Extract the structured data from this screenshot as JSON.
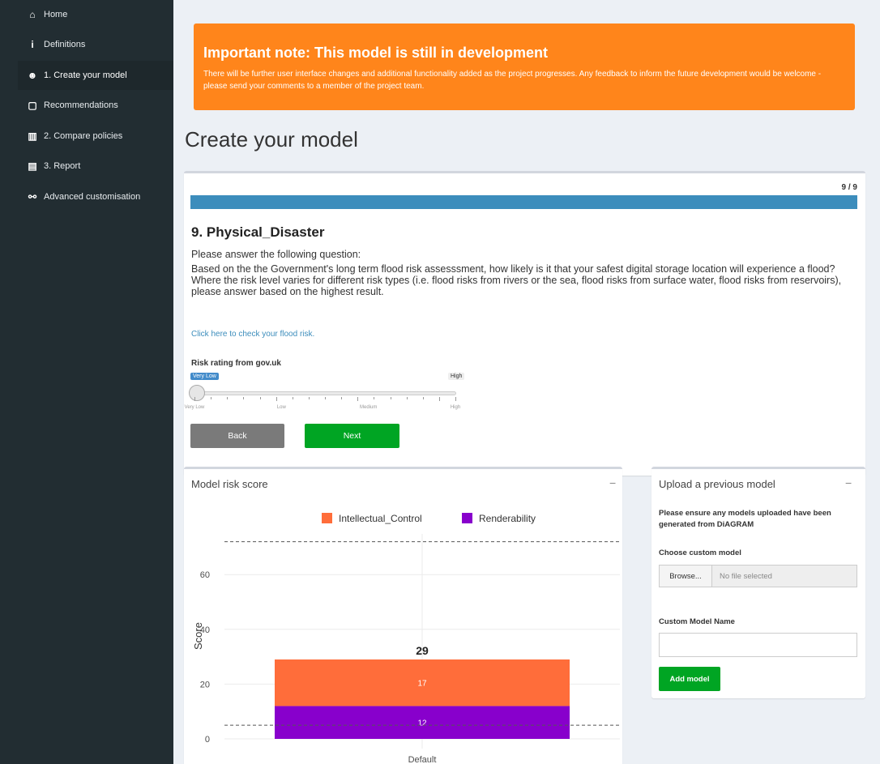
{
  "sidebar": {
    "items": [
      {
        "label": "Home",
        "icon": "home-icon",
        "glyph": "⌂"
      },
      {
        "label": "Definitions",
        "icon": "info-icon",
        "glyph": "i"
      },
      {
        "label": "1. Create your model",
        "icon": "user-edit-icon",
        "glyph": "☻"
      },
      {
        "label": "Recommendations",
        "icon": "clipboard-icon",
        "glyph": "▢"
      },
      {
        "label": "2. Compare policies",
        "icon": "bar-chart-icon",
        "glyph": "▥"
      },
      {
        "label": "3. Report",
        "icon": "book-icon",
        "glyph": "▤"
      },
      {
        "label": "Advanced customisation",
        "icon": "network-icon",
        "glyph": "⚯"
      }
    ],
    "active_index": 2
  },
  "alert": {
    "title": "Important note: This model is still in development",
    "body": "There will be further user interface changes and additional functionality added as the project progresses. Any feedback to inform the future development would be welcome - please send your comments to a member of the project team."
  },
  "page": {
    "title": "Create your model"
  },
  "question": {
    "progress_label": "9 / 9",
    "progress_fraction": 1.0,
    "title": "9. Physical_Disaster",
    "prompt": "Please answer the following question:",
    "text": "Based on the the Government's long term flood risk assesssment, how likely is it that your safest digital storage location will experience a flood? Where the risk level varies for different risk types (i.e. flood risks from rivers or the sea, flood risks from surface water, flood risks from reservoirs), please answer based on the highest result.",
    "link": "Click here to check your flood risk.",
    "slider": {
      "label": "Risk rating from gov.uk",
      "value": "Very Low",
      "min_label": "Very Low",
      "max_label": "High",
      "ticks": [
        "Very Low",
        "Low",
        "Medium",
        "High"
      ]
    },
    "back_label": "Back",
    "next_label": "Next"
  },
  "chart_panel": {
    "title": "Model risk score",
    "collapse": "−"
  },
  "chart_data": {
    "type": "bar",
    "stacked": true,
    "categories": [
      "Default"
    ],
    "series": [
      {
        "name": "Intellectual_Control",
        "values": [
          17
        ],
        "color": "#ff6d3a"
      },
      {
        "name": "Renderability",
        "values": [
          12
        ],
        "color": "#8800cc"
      }
    ],
    "total_labels": [
      "29"
    ],
    "ylabel": "Score",
    "yticks": [
      0,
      20,
      40,
      60
    ],
    "reference_lines": [
      5,
      72
    ]
  },
  "upload": {
    "title": "Upload a previous model",
    "collapse": "−",
    "note": "Please ensure any models uploaded have been generated from DiAGRAM",
    "choose_label": "Choose custom model",
    "browse_label": "Browse...",
    "file_placeholder": "No file selected",
    "name_label": "Custom Model Name",
    "name_value": "",
    "add_label": "Add model"
  }
}
